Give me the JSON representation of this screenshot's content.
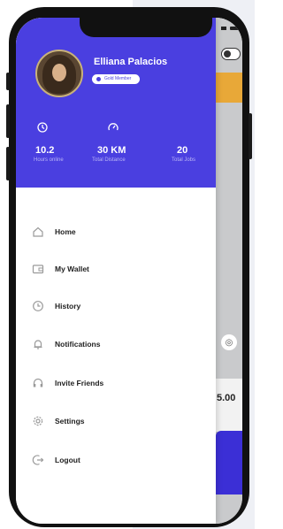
{
  "profile": {
    "name": "Elliana Palacios",
    "badge": "Gold Member"
  },
  "stats": [
    {
      "value": "10.2",
      "label": "Hours online",
      "icon": "clock-icon"
    },
    {
      "value": "30 KM",
      "label": "Total Distance",
      "icon": "speedometer-icon"
    },
    {
      "value": "20",
      "label": "Total Jobs",
      "icon": "jobs-icon"
    }
  ],
  "menu": [
    {
      "label": "Home",
      "icon": "home-icon"
    },
    {
      "label": "My Wallet",
      "icon": "wallet-icon"
    },
    {
      "label": "History",
      "icon": "history-icon"
    },
    {
      "label": "Notifications",
      "icon": "bell-icon"
    },
    {
      "label": "Invite Friends",
      "icon": "headset-icon"
    },
    {
      "label": "Settings",
      "icon": "gear-icon"
    },
    {
      "label": "Logout",
      "icon": "logout-icon"
    }
  ],
  "background_app": {
    "price": "5.00"
  },
  "colors": {
    "primary": "#4a3fe0",
    "accent": "#e8a838",
    "cta": "#3b2fd6"
  }
}
